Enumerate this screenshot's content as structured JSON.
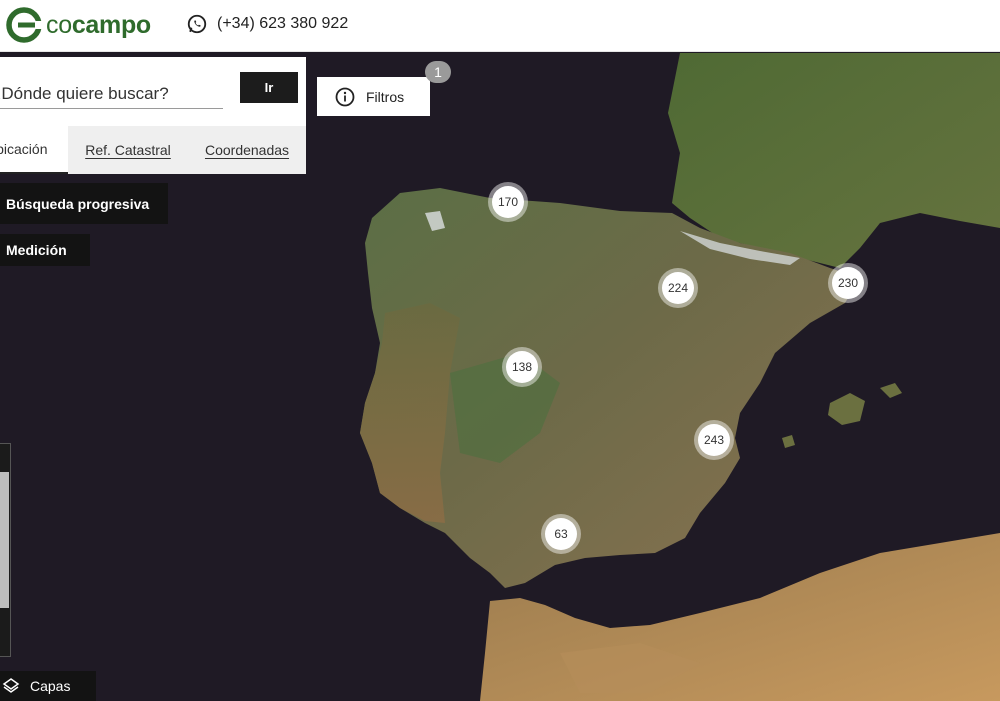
{
  "header": {
    "logo_text_co": "co",
    "logo_text_campo": "campo",
    "phone": "(+34) 623 380 922",
    "phone_icon": "whatsapp-icon"
  },
  "search": {
    "placeholder": "¿Dónde quiere buscar?",
    "value": "",
    "go_label": "Ir",
    "tabs": [
      {
        "label": "Ubicación",
        "active": true
      },
      {
        "label": "Ref. Catastral",
        "active": false
      },
      {
        "label": "Coordenadas",
        "active": false
      }
    ]
  },
  "filters": {
    "label": "Filtros",
    "icon": "info-icon",
    "badge_count": "1"
  },
  "tools": {
    "progressive_search": "Búsqueda progresiva",
    "measurement": "Medición",
    "layers": "Capas",
    "layers_icon": "layers-icon"
  },
  "clusters": [
    {
      "label": "170"
    },
    {
      "label": "224"
    },
    {
      "label": "230"
    },
    {
      "label": "138"
    },
    {
      "label": "243"
    },
    {
      "label": "63"
    }
  ],
  "colors": {
    "brand_green": "#2f6b2c",
    "sea": "#1f1a25",
    "button_dark": "#131313"
  }
}
